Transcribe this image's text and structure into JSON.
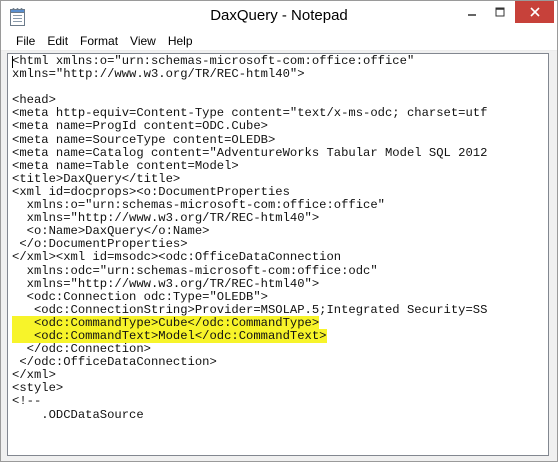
{
  "window": {
    "title": "DaxQuery - Notepad"
  },
  "icons": {
    "app": "notepad-icon",
    "minimize": "minimize-icon",
    "maximize": "maximize-icon",
    "close": "close-icon"
  },
  "colors": {
    "close_button": "#c7413a",
    "highlight": "#f7f42a"
  },
  "menu": [
    "File",
    "Edit",
    "Format",
    "View",
    "Help"
  ],
  "lines": [
    {
      "text": "<html xmlns:o=\"urn:schemas-microsoft-com:office:office\"",
      "hl": false
    },
    {
      "text": "xmlns=\"http://www.w3.org/TR/REC-html40\">",
      "hl": false
    },
    {
      "text": "",
      "hl": false
    },
    {
      "text": "<head>",
      "hl": false
    },
    {
      "text": "<meta http-equiv=Content-Type content=\"text/x-ms-odc; charset=utf",
      "hl": false
    },
    {
      "text": "<meta name=ProgId content=ODC.Cube>",
      "hl": false
    },
    {
      "text": "<meta name=SourceType content=OLEDB>",
      "hl": false
    },
    {
      "text": "<meta name=Catalog content=\"AdventureWorks Tabular Model SQL 2012",
      "hl": false
    },
    {
      "text": "<meta name=Table content=Model>",
      "hl": false
    },
    {
      "text": "<title>DaxQuery</title>",
      "hl": false
    },
    {
      "text": "<xml id=docprops><o:DocumentProperties",
      "hl": false
    },
    {
      "text": "  xmlns:o=\"urn:schemas-microsoft-com:office:office\"",
      "hl": false
    },
    {
      "text": "  xmlns=\"http://www.w3.org/TR/REC-html40\">",
      "hl": false
    },
    {
      "text": "  <o:Name>DaxQuery</o:Name>",
      "hl": false
    },
    {
      "text": " </o:DocumentProperties>",
      "hl": false
    },
    {
      "text": "</xml><xml id=msodc><odc:OfficeDataConnection",
      "hl": false
    },
    {
      "text": "  xmlns:odc=\"urn:schemas-microsoft-com:office:odc\"",
      "hl": false
    },
    {
      "text": "  xmlns=\"http://www.w3.org/TR/REC-html40\">",
      "hl": false
    },
    {
      "text": "  <odc:Connection odc:Type=\"OLEDB\">",
      "hl": false
    },
    {
      "text": "   <odc:ConnectionString>Provider=MSOLAP.5;Integrated Security=SS",
      "hl": false
    },
    {
      "text": "   <odc:CommandType>Cube</odc:CommandType>",
      "hl": true
    },
    {
      "text": "   <odc:CommandText>Model</odc:CommandText>",
      "hl": true
    },
    {
      "text": "  </odc:Connection>",
      "hl": false
    },
    {
      "text": " </odc:OfficeDataConnection>",
      "hl": false
    },
    {
      "text": "</xml>",
      "hl": false
    },
    {
      "text": "<style>",
      "hl": false
    },
    {
      "text": "<!--",
      "hl": false
    },
    {
      "text": "    .ODCDataSource",
      "hl": false
    }
  ]
}
